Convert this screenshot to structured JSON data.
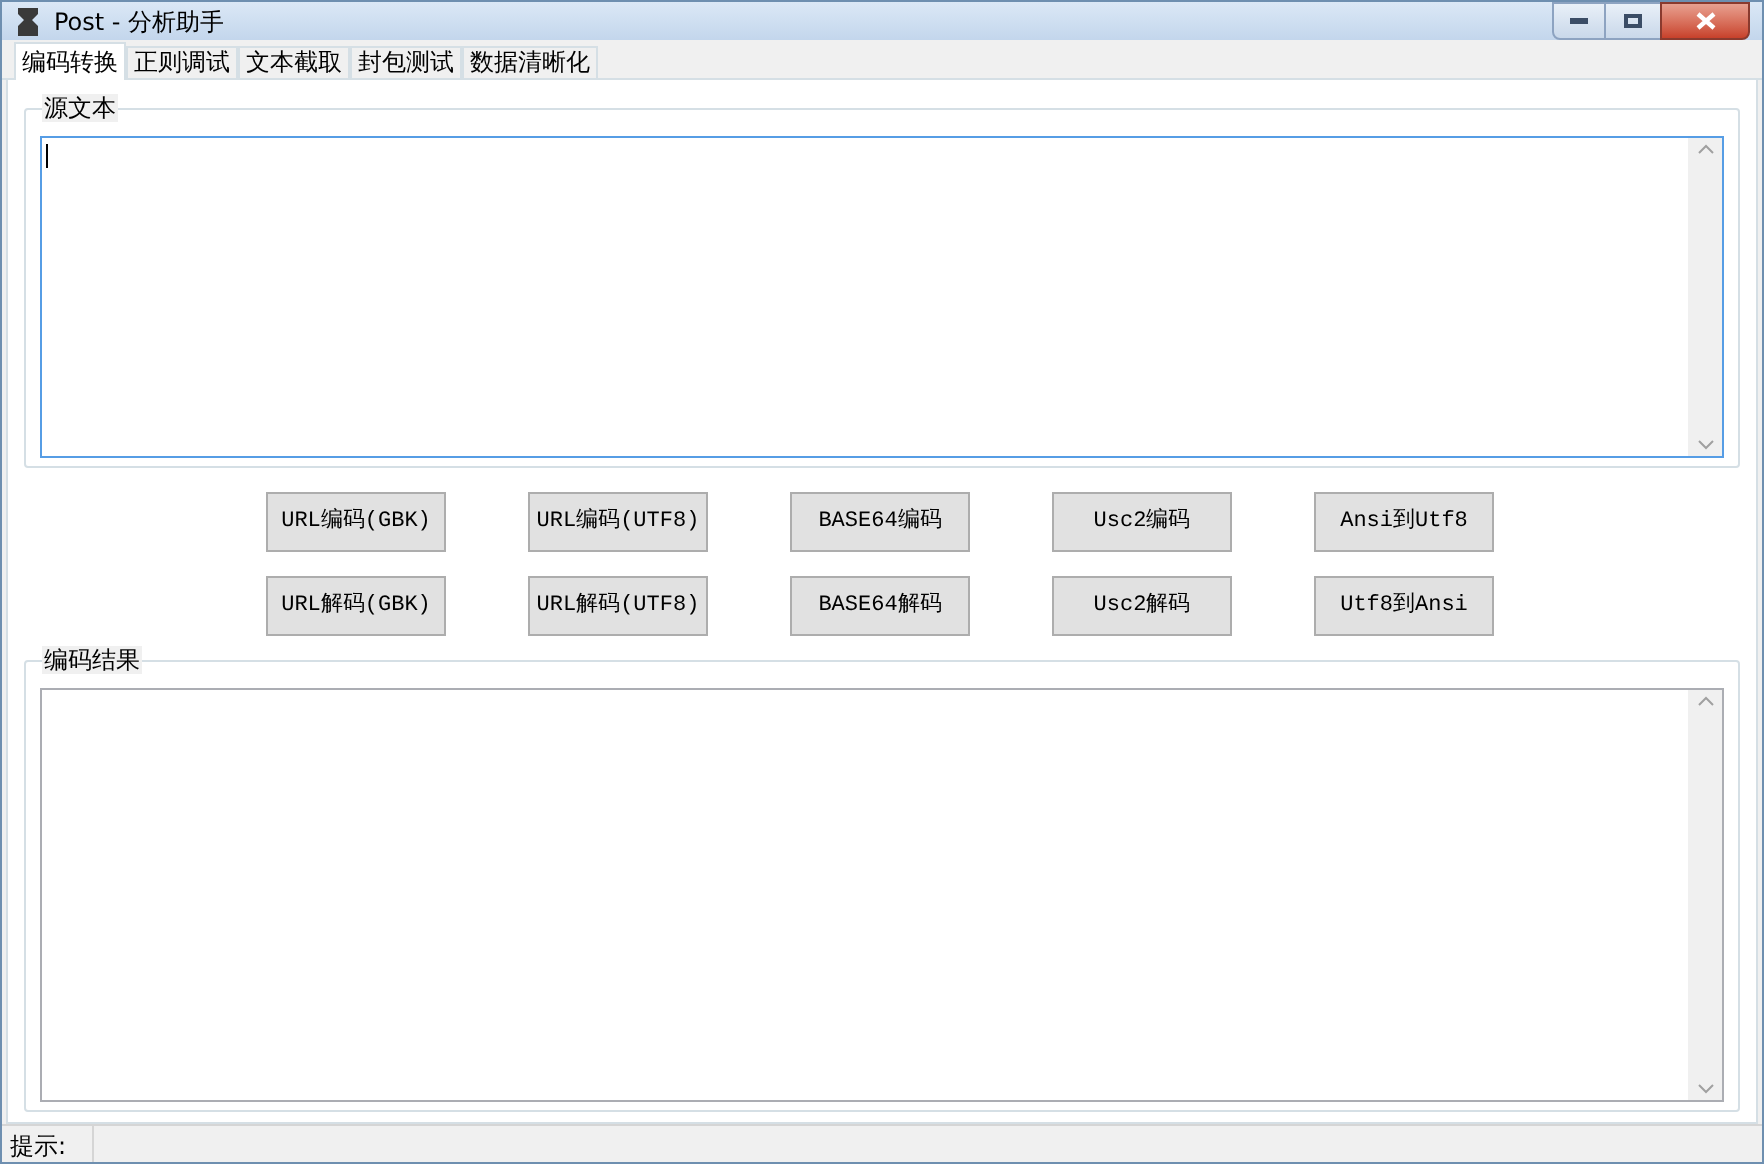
{
  "window": {
    "title": "Post - 分析助手"
  },
  "tabs": [
    {
      "label": "编码转换",
      "selected": true
    },
    {
      "label": "正则调试",
      "selected": false
    },
    {
      "label": "文本截取",
      "selected": false
    },
    {
      "label": "封包测试",
      "selected": false
    },
    {
      "label": "数据清晰化",
      "selected": false
    }
  ],
  "source": {
    "label": "源文本"
  },
  "buttons": [
    [
      "URL编码(GBK)",
      "URL编码(UTF8)",
      "BASE64编码",
      "Usc2编码",
      "Ansi到Utf8"
    ],
    [
      "URL解码(GBK)",
      "URL解码(UTF8)",
      "BASE64解码",
      "Usc2解码",
      "Utf8到Ansi"
    ]
  ],
  "result": {
    "label": "编码结果"
  },
  "status_bar": {
    "label": "提示:"
  }
}
